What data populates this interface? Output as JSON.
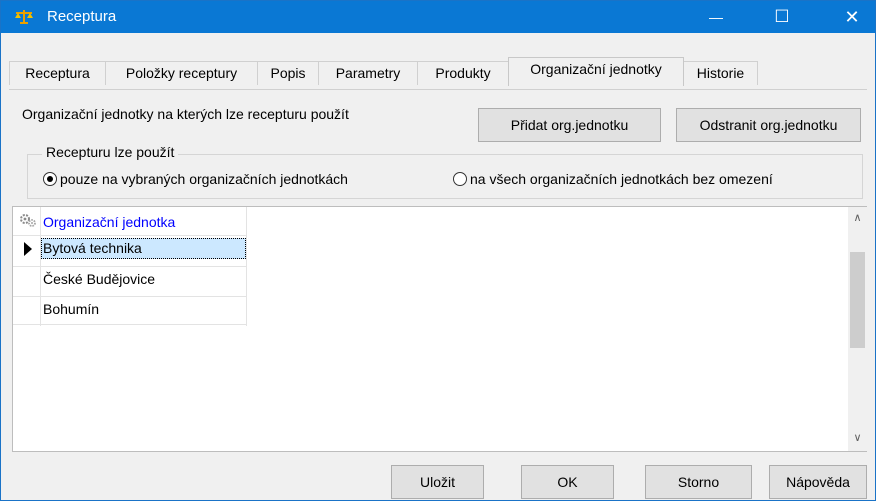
{
  "window": {
    "title": "Receptura",
    "controls": {
      "minimize": "—",
      "maximize": "☐",
      "close": "✕"
    }
  },
  "tabs": [
    {
      "label": "Receptura",
      "active": false
    },
    {
      "label": "Položky receptury",
      "active": false
    },
    {
      "label": "Popis",
      "active": false
    },
    {
      "label": "Parametry",
      "active": false
    },
    {
      "label": "Produkty",
      "active": false
    },
    {
      "label": "Organizační jednotky",
      "active": true
    },
    {
      "label": "Historie",
      "active": false
    }
  ],
  "panel": {
    "description": "Organizační jednotky na kterých lze recepturu použít",
    "add_button": "Přidat org.jednotku",
    "remove_button": "Odstranit org.jednotku",
    "group_label": "Recepturu lze použít",
    "radio_selected": "pouze na vybraných organizačních jednotkách",
    "radio_other": "na všech organizačních jednotkách bez omezení"
  },
  "grid": {
    "header": "Organizační jednotka",
    "rows": [
      {
        "name": "Bytová technika",
        "selected": true
      },
      {
        "name": "České Budějovice",
        "selected": false
      },
      {
        "name": "Bohumín",
        "selected": false
      }
    ],
    "scroll_up": "∧",
    "scroll_down": "∨"
  },
  "footer": {
    "save": "Uložit",
    "ok": "OK",
    "cancel": "Storno",
    "help": "Nápověda"
  },
  "colors": {
    "titlebar": "#0a78d4",
    "header_text": "#0000ff",
    "selection": "#cce8ff"
  }
}
